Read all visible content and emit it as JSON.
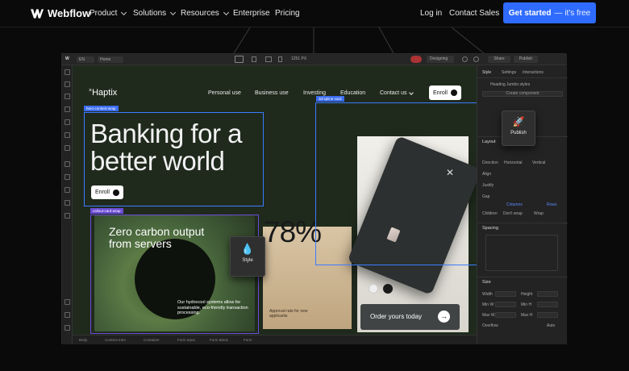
{
  "site_nav": {
    "brand": "Webflow",
    "items": [
      {
        "label": "Product"
      },
      {
        "label": "Solutions"
      },
      {
        "label": "Resources"
      },
      {
        "label": "Enterprise"
      },
      {
        "label": "Pricing"
      }
    ],
    "login": "Log in",
    "contact": "Contact Sales",
    "cta": "Get started",
    "cta_sub": "— it's free"
  },
  "designer": {
    "toolbar": {
      "locale": "EN",
      "page": "Home",
      "width": "1251 PX",
      "mode": "Designing",
      "share": "Share",
      "publish": "Publish"
    },
    "canvas": {
      "brand": "Haptix",
      "nav": [
        "Personal use",
        "Business use",
        "Investing",
        "Education",
        "Contact us"
      ],
      "enroll": "Enroll",
      "hero": "Banking for a better world",
      "hero_enroll": "Enroll",
      "tags": {
        "hero_wrap": "hero-content-wrap",
        "spline": "3d-spline-card",
        "callout": "callout-card-wrap"
      },
      "green_card": {
        "title": "Zero carbon output from servers",
        "body": "Our hydrocool systems allow for sustainable, eco-friendly transaction processing."
      },
      "stat": {
        "value": "78%",
        "caption": "Approval rate for new applicants"
      },
      "order": "Order yours today",
      "style_tooltip": "Style",
      "publish_tooltip": "Publish"
    },
    "right_panel": {
      "tabs": [
        "Style",
        "Settings",
        "Interactions"
      ],
      "selector": "Heading Jumbo styles",
      "create": "Create component",
      "sections": [
        "Layout",
        "Spacing",
        "Size"
      ],
      "layout_opts": [
        "Direction",
        "Horizontal",
        "Vertical",
        "Align",
        "Justify",
        "Gap",
        "Columns",
        "Rows",
        "Children",
        "Don't wrap",
        "Wrap"
      ],
      "size_labels": [
        "Width",
        "Height",
        "Min W",
        "Min H",
        "Max W",
        "Max H",
        "Overflow",
        "Auto"
      ],
      "size_value": "Auto"
    },
    "breadcrumb": [
      "Body",
      "Content Intro",
      "Container",
      "Form Input",
      "Form Block",
      "Form"
    ]
  }
}
